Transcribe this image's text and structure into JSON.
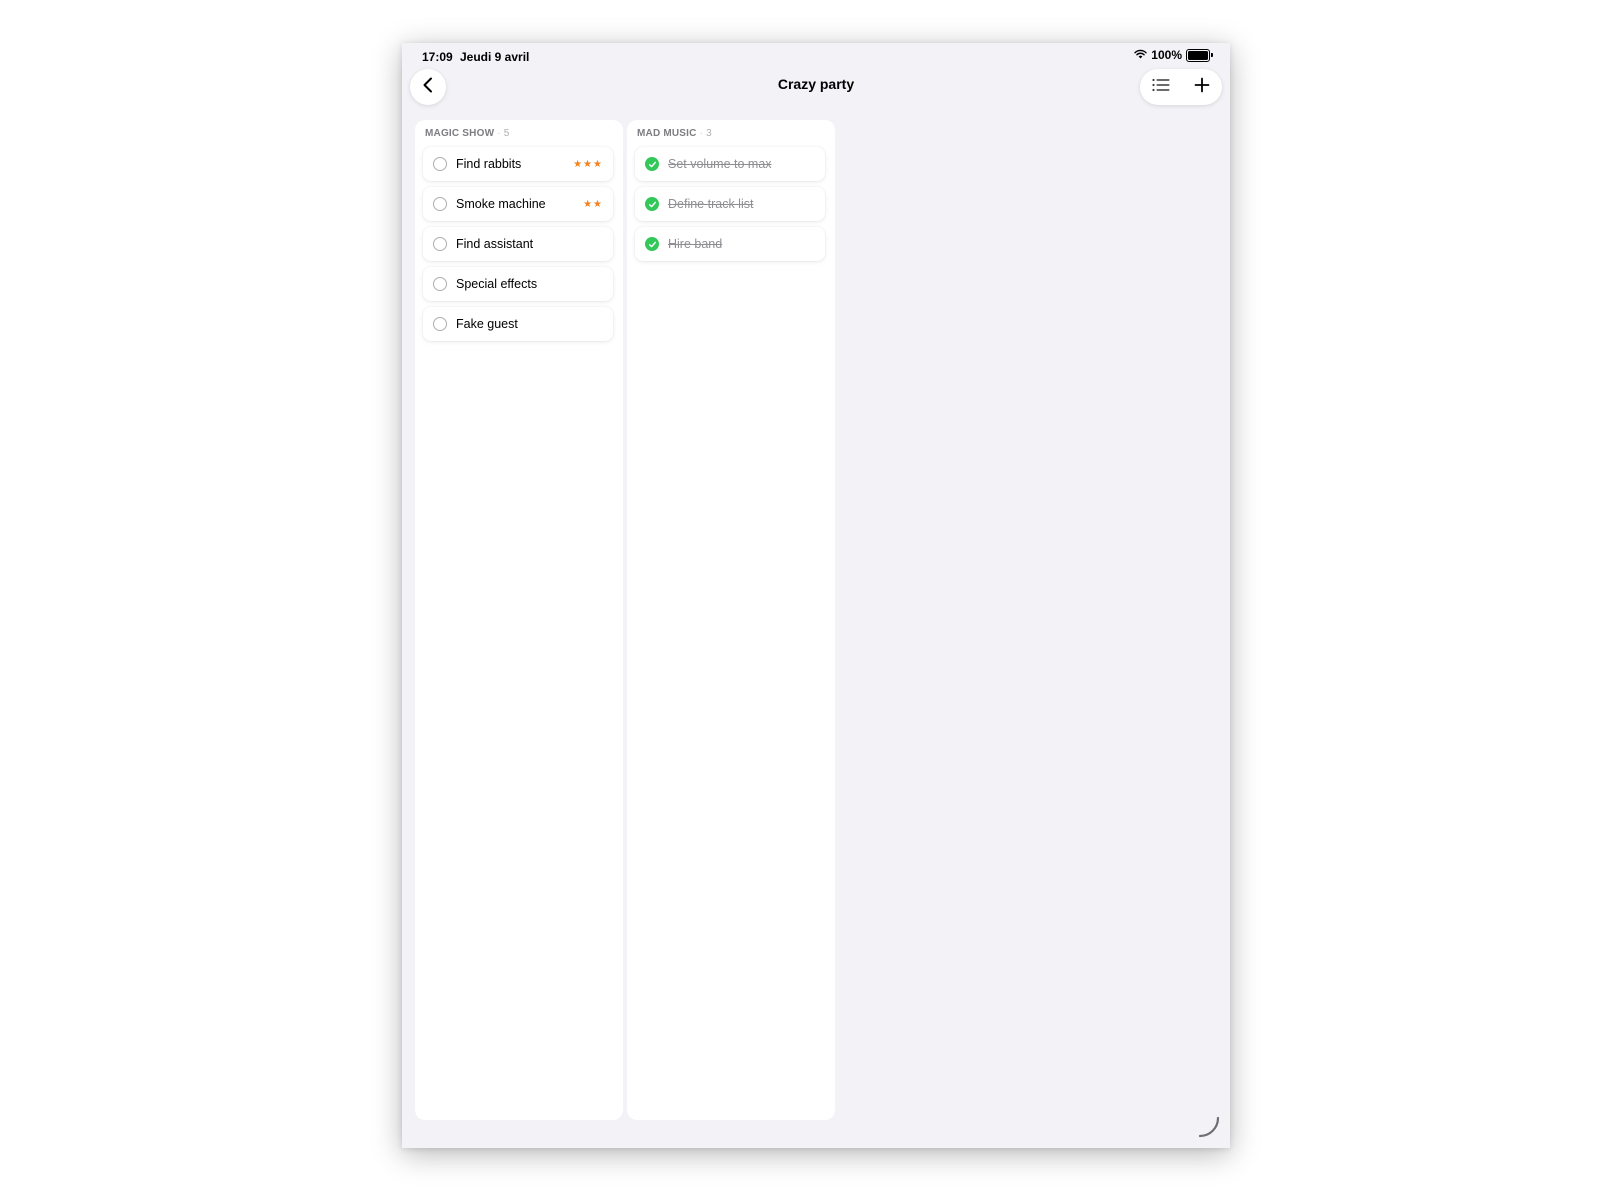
{
  "status_bar": {
    "time": "17:09",
    "date": "Jeudi 9 avril",
    "battery": "100%",
    "wifi_icon": "wifi-icon",
    "battery_icon": "battery-icon"
  },
  "nav": {
    "title": "Crazy party",
    "back_icon": "chevron-left-icon",
    "list_icon": "list-icon",
    "add_icon": "plus-icon"
  },
  "columns": [
    {
      "title": "MAGIC SHOW",
      "count": "5",
      "tasks": [
        {
          "label": "Find rabbits",
          "stars": "★★★",
          "done": false
        },
        {
          "label": "Smoke machine",
          "stars": "★★",
          "done": false
        },
        {
          "label": "Find assistant",
          "stars": "",
          "done": false
        },
        {
          "label": "Special effects",
          "stars": "",
          "done": false
        },
        {
          "label": "Fake guest",
          "stars": "",
          "done": false
        }
      ]
    },
    {
      "title": "MAD MUSIC",
      "count": "3",
      "tasks": [
        {
          "label": "Set volume to max",
          "stars": "",
          "done": true
        },
        {
          "label": "Define track list",
          "stars": "",
          "done": true
        },
        {
          "label": "Hire band",
          "stars": "",
          "done": true
        }
      ]
    }
  ],
  "colors": {
    "background": "#f2f2f7",
    "star": "#f5821f",
    "check_done": "#34c759",
    "done_text": "#8e8e93"
  }
}
